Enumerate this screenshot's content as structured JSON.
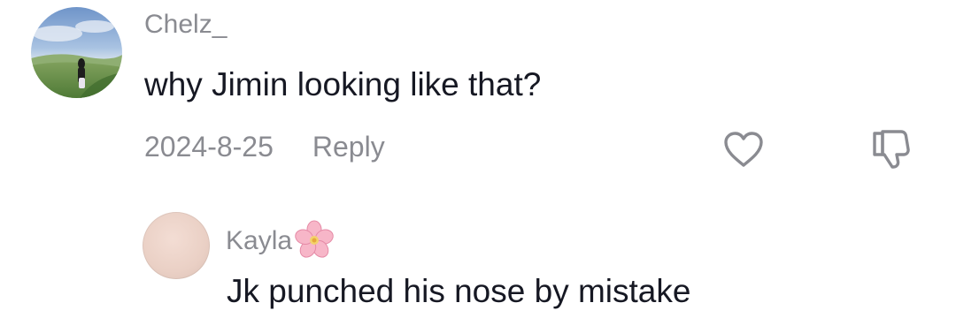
{
  "comment": {
    "username": "Chelz_",
    "text": "why Jimin looking like that?",
    "date": "2024-8-25",
    "reply_label": "Reply",
    "avatar_icon": "profile-photo-landscape",
    "like_icon": "heart-outline-icon",
    "dislike_icon": "thumbs-down-outline-icon"
  },
  "reply": {
    "username": "Kayla",
    "username_emoji": "cherry-blossom",
    "text": "Jk punched his nose by mistake",
    "avatar_icon": "blank-avatar"
  },
  "colors": {
    "primary_text": "#161823",
    "secondary_text": "#8a8b91",
    "icon": "#8a8b91"
  }
}
